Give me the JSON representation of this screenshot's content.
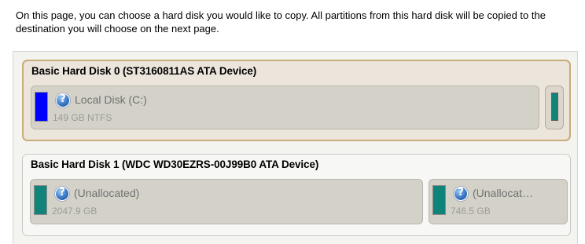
{
  "intro_text": "On this page, you can choose a hard disk you would like to copy. All partitions from this hard disk will be copied to the destination you will choose on the next page.",
  "colors": {
    "system_partition": "#0000ff",
    "unallocated": "#108479"
  },
  "disks": [
    {
      "title": "Basic Hard Disk 0 (ST3160811AS ATA Device)",
      "selected": true,
      "partitions": [
        {
          "name": "Local Disk (C:)",
          "size": "149 GB NTFS",
          "icon": "help-icon"
        }
      ]
    },
    {
      "title": "Basic Hard Disk 1 (WDC WD30EZRS-00J99B0 ATA Device)",
      "selected": false,
      "partitions": [
        {
          "name": "(Unallocated)",
          "size": "2047.9 GB",
          "icon": "help-icon"
        },
        {
          "name": "(Unallocat…",
          "size": "746.5 GB",
          "icon": "help-icon"
        }
      ]
    }
  ]
}
